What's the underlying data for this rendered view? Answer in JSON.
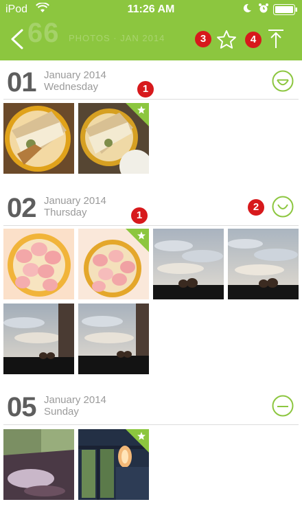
{
  "status": {
    "carrier": "iPod",
    "time": "11:26 AM"
  },
  "header": {
    "ghost_number": "66",
    "ghost_text": "PHOTOS · JAN 2014"
  },
  "markers": {
    "m1": "1",
    "m2": "2",
    "m3": "3",
    "m4": "4"
  },
  "days": [
    {
      "day": "01",
      "month": "January 2014",
      "weekday": "Wednesday",
      "mood": "happy",
      "photos": 2,
      "favorite_index": 1
    },
    {
      "day": "02",
      "month": "January 2014",
      "weekday": "Thursday",
      "mood": "smile",
      "photos": 6,
      "favorite_index": 1
    },
    {
      "day": "05",
      "month": "January 2014",
      "weekday": "Sunday",
      "mood": "neutral",
      "photos": 2,
      "favorite_index": 1
    }
  ],
  "colors": {
    "brand": "#8cc63f",
    "marker": "#d7191c",
    "text_dark": "#5e5e5e",
    "text_light": "#9a9a9a"
  }
}
